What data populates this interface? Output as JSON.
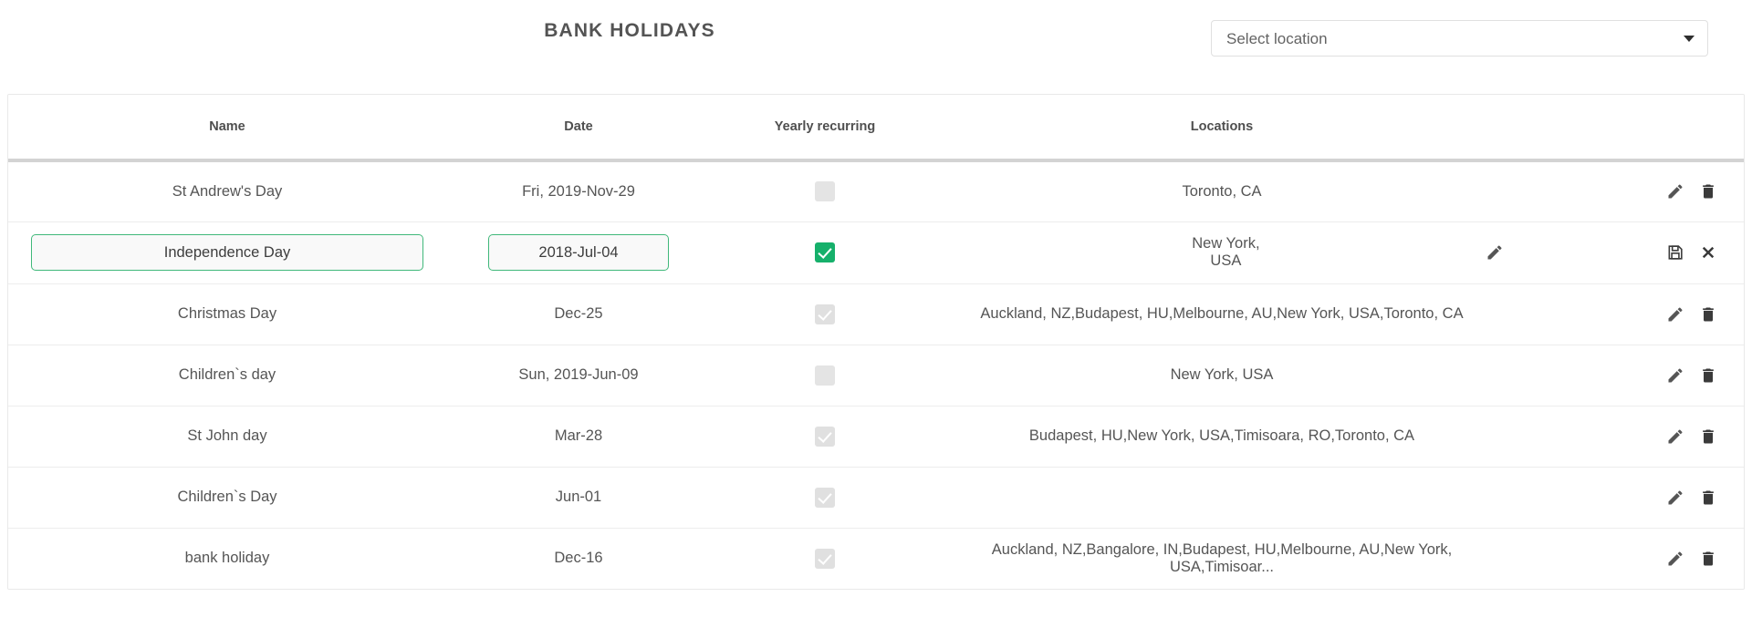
{
  "header": {
    "title": "BANK HOLIDAYS",
    "location_select": {
      "value": "Select location",
      "caret_icon": "chevron-down-icon"
    }
  },
  "table": {
    "columns": [
      "Name",
      "Date",
      "Yearly recurring",
      "Locations"
    ],
    "rows": [
      {
        "name": "St Andrew's Day",
        "date": "Fri, 2019-Nov-29",
        "recurring": false,
        "recurring_disabled": false,
        "locations": "Toronto, CA",
        "editing": false
      },
      {
        "name": "Independence Day",
        "date": "2018-Jul-04",
        "recurring": true,
        "recurring_disabled": false,
        "locations": "New York, USA",
        "editing": true
      },
      {
        "name": "Christmas Day",
        "date": "Dec-25",
        "recurring": true,
        "recurring_disabled": true,
        "locations": "Auckland, NZ,Budapest, HU,Melbourne, AU,New York, USA,Toronto, CA",
        "editing": false
      },
      {
        "name": "Children`s day",
        "date": "Sun, 2019-Jun-09",
        "recurring": false,
        "recurring_disabled": false,
        "locations": "New York, USA",
        "editing": false
      },
      {
        "name": "St John day",
        "date": "Mar-28",
        "recurring": true,
        "recurring_disabled": true,
        "locations": "Budapest, HU,New York, USA,Timisoara, RO,Toronto, CA",
        "editing": false
      },
      {
        "name": "Children`s Day",
        "date": "Jun-01",
        "recurring": true,
        "recurring_disabled": true,
        "locations": "",
        "editing": false
      },
      {
        "name": "bank holiday",
        "date": "Dec-16",
        "recurring": true,
        "recurring_disabled": true,
        "locations": "Auckland, NZ,Bangalore, IN,Budapest, HU,Melbourne, AU,New York, USA,Timisoar...",
        "editing": false
      }
    ],
    "row_actions": {
      "edit_icon": "pencil-icon",
      "delete_icon": "trash-icon",
      "save_icon": "floppy-save-icon",
      "cancel_icon": "close-x-icon",
      "locations_edit_icon": "pencil-icon"
    }
  },
  "colors": {
    "accent_green": "#16b06b",
    "input_border_green": "#40b87a",
    "text": "#555555",
    "header_divider": "#d3d3d3",
    "row_divider": "#ededed",
    "checkbox_off": "#e4e4e4",
    "checkbox_disabled": "#e0e0e0"
  }
}
